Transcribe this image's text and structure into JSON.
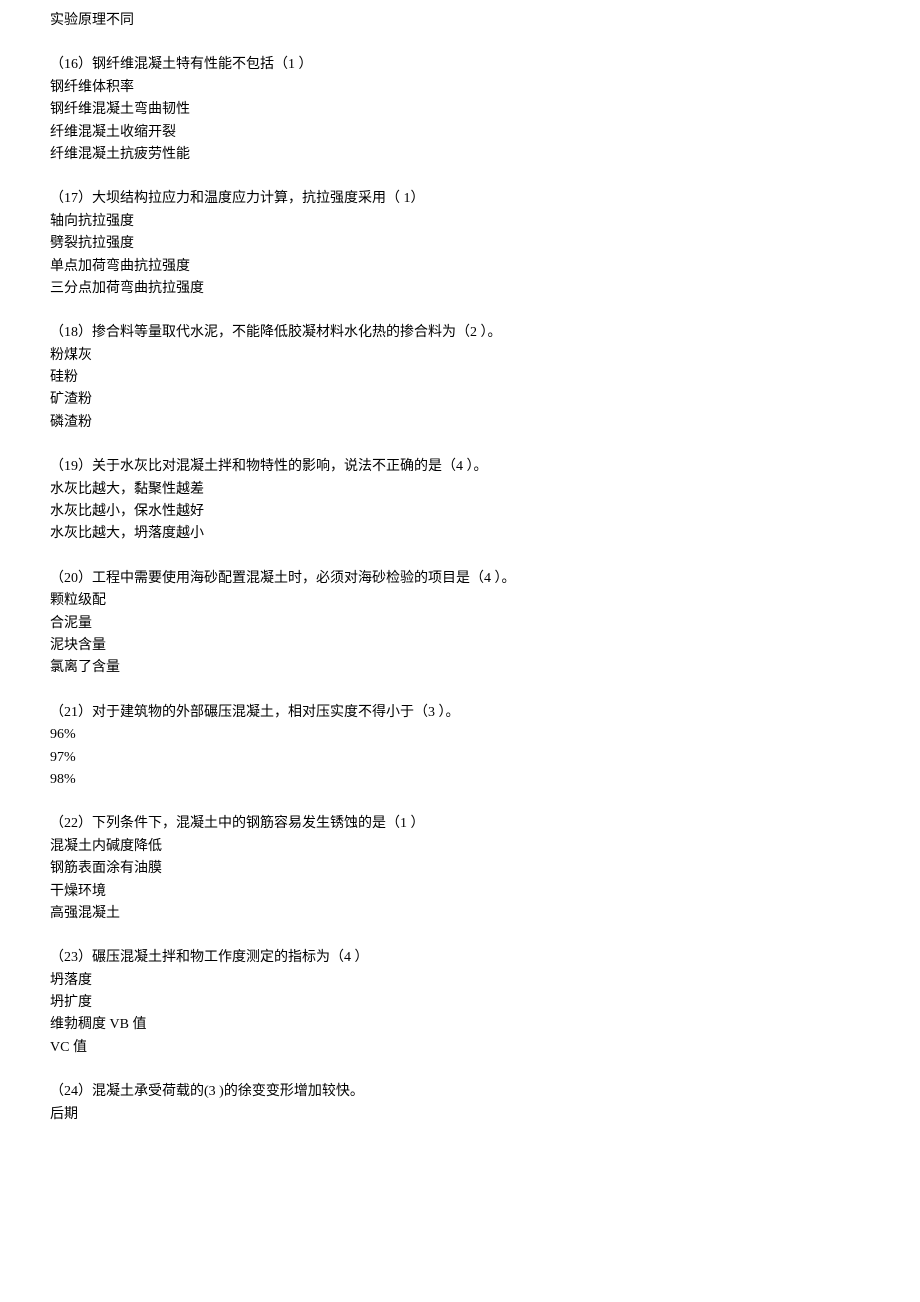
{
  "preline": "实验原理不同",
  "questions": [
    {
      "stem": "（16）钢纤维混凝土特有性能不包括（1 ）",
      "options": [
        "钢纤维体积率",
        "钢纤维混凝土弯曲韧性",
        "纤维混凝土收缩开裂",
        "纤维混凝土抗疲劳性能"
      ]
    },
    {
      "stem": "（17）大坝结构拉应力和温度应力计算，抗拉强度采用（ 1）",
      "options": [
        "轴向抗拉强度",
        "劈裂抗拉强度",
        "单点加荷弯曲抗拉强度",
        "三分点加荷弯曲抗拉强度"
      ]
    },
    {
      "stem": "（18）掺合料等量取代水泥，不能降低胶凝材料水化热的掺合料为（2 ）。",
      "options": [
        "粉煤灰",
        "硅粉",
        "矿渣粉",
        "磷渣粉"
      ]
    },
    {
      "stem": "（19）关于水灰比对混凝土拌和物特性的影响，说法不正确的是（4 ）。",
      "options": [
        "水灰比越大，黏聚性越差",
        "水灰比越小，保水性越好",
        "水灰比越大，坍落度越小"
      ]
    },
    {
      "stem": "（20）工程中需要使用海砂配置混凝土时，必须对海砂检验的项目是（4 ）。",
      "options": [
        "颗粒级配",
        "合泥量",
        "泥块含量",
        "氯离了含量"
      ]
    },
    {
      "stem": "（21）对于建筑物的外部碾压混凝土，相对压实度不得小于（3 ）。",
      "options": [
        "96%",
        "97%",
        "98%"
      ]
    },
    {
      "stem": "（22）下列条件下，混凝土中的钢筋容易发生锈蚀的是（1 ）",
      "options": [
        "混凝土内碱度降低",
        "钢筋表面涂有油膜",
        "干燥环境",
        "高强混凝土"
      ]
    },
    {
      "stem": "（23）碾压混凝土拌和物工作度测定的指标为（4 ）",
      "options": [
        "坍落度",
        "坍扩度",
        "维勃稠度 VB 值",
        "VC 值"
      ]
    },
    {
      "stem": "（24）混凝土承受荷载的(3 )的徐变变形增加较快。",
      "options": [
        "后期"
      ]
    }
  ]
}
